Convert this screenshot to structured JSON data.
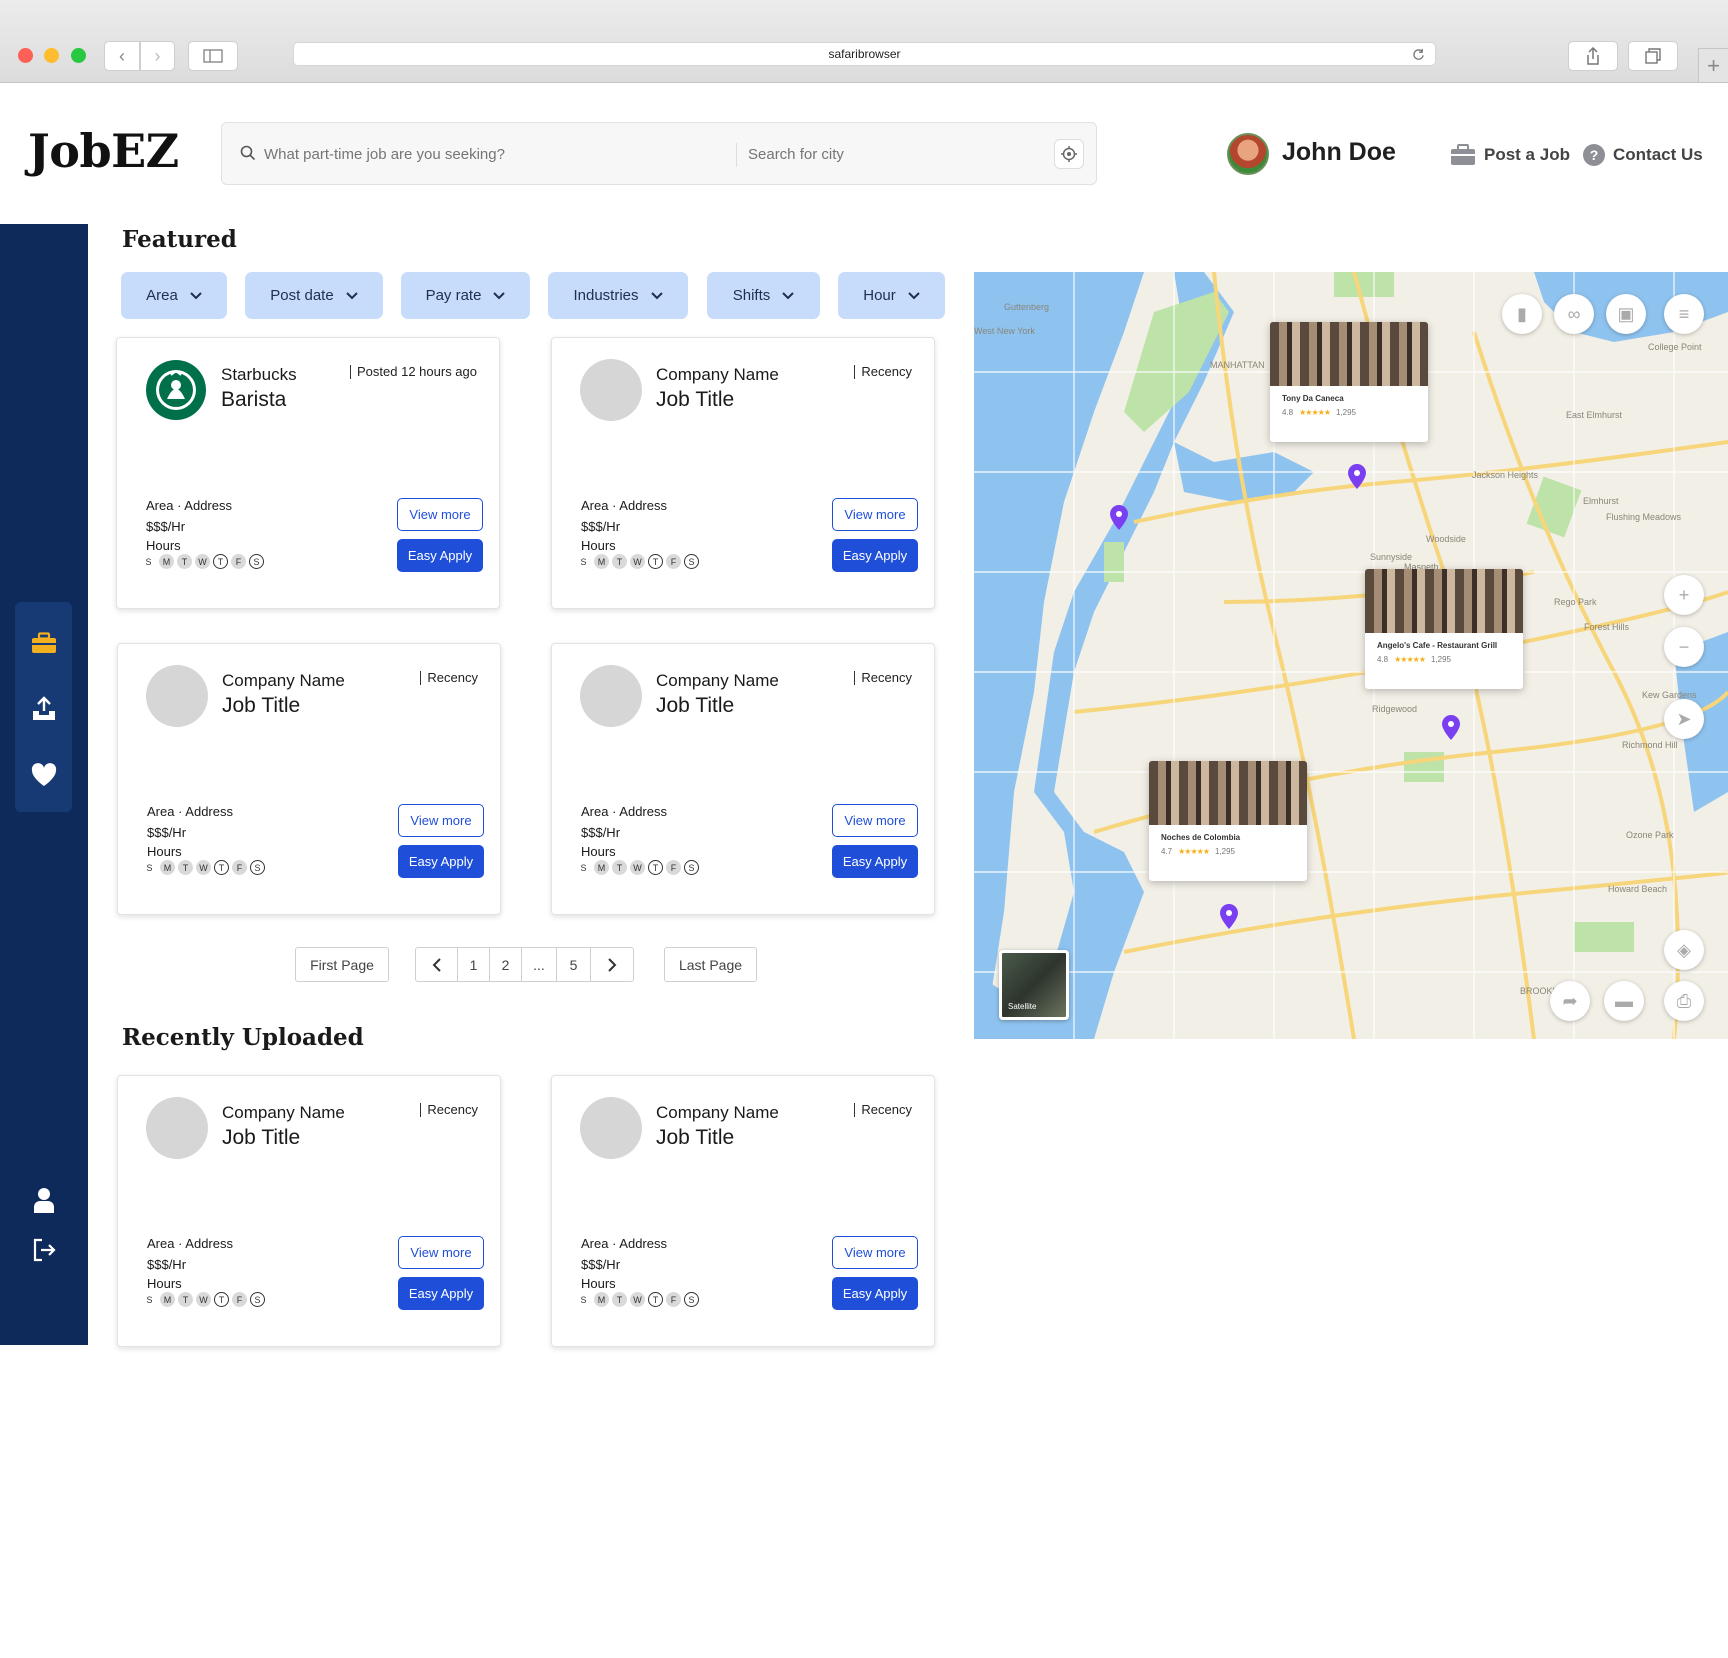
{
  "browser": {
    "url": "safaribrowser",
    "new_tab": "+"
  },
  "header": {
    "logo": "JobEZ",
    "search_placeholder": "What part-time job are you seeking?",
    "city_placeholder": "Search for city",
    "user_name": "John Doe",
    "post_job": "Post a Job",
    "contact_us": "Contact Us"
  },
  "featured": {
    "title": "Featured",
    "filters": [
      "Area",
      "Post date",
      "Pay rate",
      "Industries",
      "Shifts",
      "Hour"
    ],
    "cards": [
      {
        "company": "Starbucks",
        "title": "Barista",
        "recency": "Posted 12 hours ago",
        "area": "Area · Address",
        "pay": "$$$/Hr",
        "hours": "Hours",
        "view": "View more",
        "apply": "Easy Apply",
        "logo": "starbucks-logo"
      },
      {
        "company": "Company Name",
        "title": "Job Title",
        "recency": "Recency",
        "area": "Area · Address",
        "pay": "$$$/Hr",
        "hours": "Hours",
        "view": "View more",
        "apply": "Easy Apply"
      },
      {
        "company": "Company Name",
        "title": "Job Title",
        "recency": "Recency",
        "area": "Area · Address",
        "pay": "$$$/Hr",
        "hours": "Hours",
        "view": "View more",
        "apply": "Easy Apply"
      },
      {
        "company": "Company Name",
        "title": "Job Title",
        "recency": "Recency",
        "area": "Area · Address",
        "pay": "$$$/Hr",
        "hours": "Hours",
        "view": "View more",
        "apply": "Easy Apply"
      }
    ]
  },
  "days": [
    "S",
    "M",
    "T",
    "W",
    "T",
    "F",
    "S"
  ],
  "pagination": {
    "first": "First Page",
    "last": "Last Page",
    "pages": [
      "1",
      "2",
      "...",
      "5"
    ]
  },
  "recent": {
    "title": "Recently Uploaded",
    "cards": [
      {
        "company": "Company Name",
        "title": "Job Title",
        "recency": "Recency",
        "area": "Area · Address",
        "pay": "$$$/Hr",
        "hours": "Hours",
        "view": "View more",
        "apply": "Easy Apply"
      },
      {
        "company": "Company Name",
        "title": "Job Title",
        "recency": "Recency",
        "area": "Area · Address",
        "pay": "$$$/Hr",
        "hours": "Hours",
        "view": "View more",
        "apply": "Easy Apply"
      }
    ]
  },
  "map": {
    "places": [
      {
        "name": "Tony Da Caneca",
        "rating": "4.8",
        "stars": "★★★★★",
        "reviews": "1,295"
      },
      {
        "name": "Angelo's Cafe - Restaurant Grill",
        "rating": "4.8",
        "stars": "★★★★★",
        "reviews": "1,295"
      },
      {
        "name": "Noches de Colombia",
        "rating": "4.7",
        "stars": "★★★★★",
        "reviews": "1,295"
      }
    ],
    "satellite": "Satellite",
    "labels": [
      "Guttenberg",
      "West New York",
      "MANHATTAN",
      "Jackson Heights",
      "Elmhurst",
      "Sunnyside",
      "Woodside",
      "Maspeth",
      "Rego Park",
      "Forest Hills",
      "Kew Gardens",
      "Richmond Hill",
      "Ozone Park",
      "Howard Beach",
      "Ridgewood",
      "BROOKLYN",
      "College Point",
      "East Elmhurst",
      "Flushing Meadows"
    ]
  },
  "colors": {
    "sidebar": "#0e2a5b",
    "accent": "#1f4fd8",
    "chip": "#c6dcfa",
    "pin": "#7b3ff2",
    "briefcase": "#f2b01e"
  }
}
